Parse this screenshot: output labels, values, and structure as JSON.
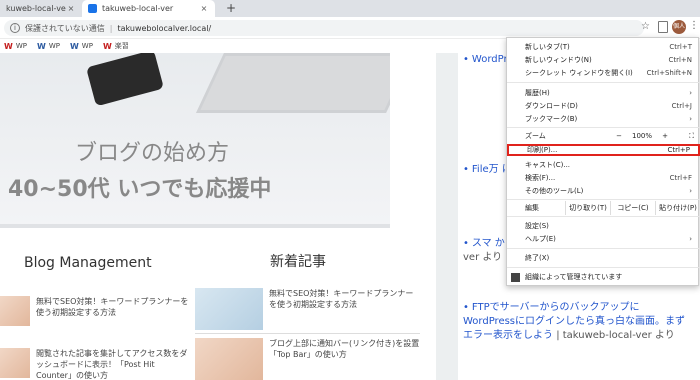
{
  "tabs": [
    {
      "label": "kuweb-local-ver › ..."
    },
    {
      "label": "takuweb-local-ver"
    }
  ],
  "omnibox": {
    "security_text": "保護されていない通信",
    "url": "takuwebolocalver.local/"
  },
  "bookmarks": [
    {
      "icon": "W",
      "label": "WP"
    },
    {
      "icon": "W",
      "label": "WP"
    },
    {
      "icon": "W",
      "label": "WP"
    },
    {
      "icon": "W",
      "label": "楽習"
    }
  ],
  "avatar_text": "個人",
  "hero": {
    "title": "ブログの始め方",
    "subtitle": "40~50代 いつでも応援中"
  },
  "sections": {
    "left_title": "Blog Management",
    "right_title": "新着記事"
  },
  "articles": [
    {
      "title": "無料でSEO対策！キーワードプランナーを使う初期設定する方法"
    },
    {
      "title": "閲覧された記事を集計してアクセス数をダッシュボードに表示！「Post Hit Counter」の使い方"
    },
    {
      "title": "無料でSEO対策！キーワードプランナーを使う初期設定する方法"
    },
    {
      "title": "ブログ上部に通知バー(リンク付き)を設置「Top Bar」の使い方"
    }
  ],
  "sidebar": [
    {
      "text": "WordPressのスサ…とエ",
      "muted": ""
    },
    {
      "text": "File万 に Word 除した ver",
      "muted": ""
    },
    {
      "text": "スマ から を ス 応を目指そう",
      "muted": "| takuweb-local-ver より"
    },
    {
      "text": "FTPでサーバーからのバックアップに WordPressにログインしたら真っ白な画面。まずエラー表示をしよう",
      "muted": "| takuweb-local-ver より"
    }
  ],
  "menu": {
    "items": [
      {
        "label": "新しいタブ(T)",
        "shortcut": "Ctrl+T"
      },
      {
        "label": "新しいウィンドウ(N)",
        "shortcut": "Ctrl+N"
      },
      {
        "label": "シークレット ウィンドウを開く(I)",
        "shortcut": "Ctrl+Shift+N"
      },
      {
        "label": "履歴(H)",
        "shortcut": ""
      },
      {
        "label": "ダウンロード(D)",
        "shortcut": "Ctrl+J"
      },
      {
        "label": "ブックマーク(B)",
        "shortcut": ""
      },
      {
        "label": "キャスト(C)...",
        "shortcut": ""
      },
      {
        "label": "検索(F)...",
        "shortcut": "Ctrl+F"
      },
      {
        "label": "その他のツール(L)",
        "shortcut": ""
      },
      {
        "label": "設定(S)",
        "shortcut": ""
      },
      {
        "label": "ヘルプ(E)",
        "shortcut": ""
      },
      {
        "label": "終了(X)",
        "shortcut": ""
      }
    ],
    "zoom": {
      "label": "ズーム",
      "minus": "−",
      "value": "100%",
      "plus": "+"
    },
    "print": {
      "label": "印刷(P)...",
      "shortcut": "Ctrl+P"
    },
    "edit": {
      "label": "編集",
      "cut": "切り取り(T)",
      "copy": "コピー(C)",
      "paste": "貼り付け(P)"
    },
    "managed": "組織によって管理されています"
  }
}
